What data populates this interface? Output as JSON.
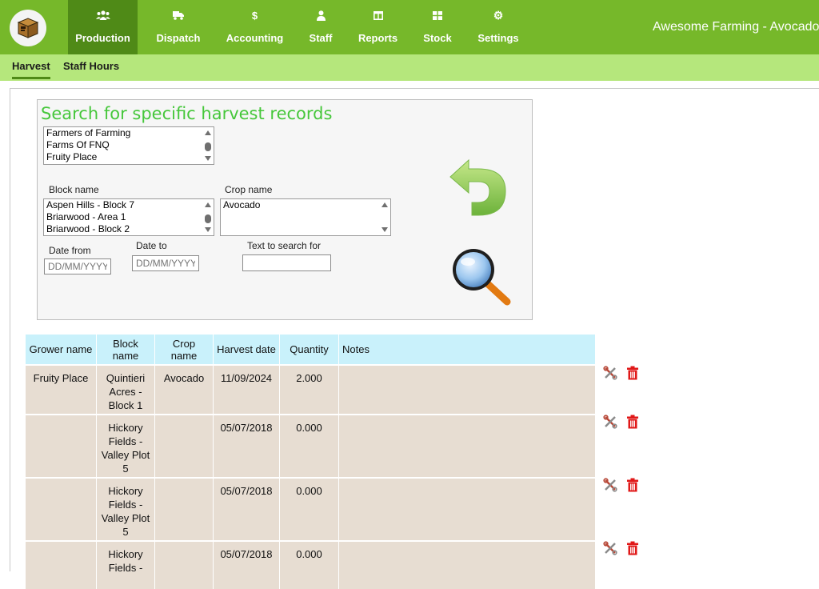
{
  "app": {
    "title": "Awesome Farming - Avocado"
  },
  "nav": [
    {
      "id": "production",
      "label": "Production",
      "icon": "users-icon"
    },
    {
      "id": "dispatch",
      "label": "Dispatch",
      "icon": "truck-icon"
    },
    {
      "id": "accounting",
      "label": "Accounting",
      "icon": "dollar-icon"
    },
    {
      "id": "staff",
      "label": "Staff",
      "icon": "user-icon"
    },
    {
      "id": "reports",
      "label": "Reports",
      "icon": "columns-icon"
    },
    {
      "id": "stock",
      "label": "Stock",
      "icon": "grid-icon"
    },
    {
      "id": "settings",
      "label": "Settings",
      "icon": "gear-icon"
    }
  ],
  "subnav": [
    {
      "label": "Harvest",
      "active": true
    },
    {
      "label": "Staff Hours",
      "active": false
    }
  ],
  "search": {
    "title": "Search for specific harvest records",
    "growers": [
      "Farmers of Farming",
      "Farms Of FNQ",
      "Fruity Place"
    ],
    "block_label": "Block name",
    "blocks": [
      "Aspen Hills - Block 7",
      "Briarwood - Area 1",
      "Briarwood - Block 2"
    ],
    "crop_label": "Crop name",
    "crops": [
      "Avocado"
    ],
    "date_from_label": "Date from",
    "date_to_label": "Date to",
    "date_placeholder": "DD/MM/YYYY",
    "text_label": "Text to search for",
    "text_value": "",
    "back_icon": "undo-arrow-icon",
    "search_icon": "magnifier-icon"
  },
  "table": {
    "headers": [
      "Grower name",
      "Block name",
      "Crop name",
      "Harvest date",
      "Quantity",
      "Notes"
    ],
    "rows": [
      {
        "grower": "Fruity Place",
        "block": "Quintieri Acres - Block 1",
        "crop": "Avocado",
        "date": "11/09/2024",
        "quantity": "2.000",
        "notes": ""
      },
      {
        "grower": "",
        "block": "Hickory Fields - Valley Plot 5",
        "crop": "",
        "date": "05/07/2018",
        "quantity": "0.000",
        "notes": ""
      },
      {
        "grower": "",
        "block": "Hickory Fields - Valley Plot 5",
        "crop": "",
        "date": "05/07/2018",
        "quantity": "0.000",
        "notes": ""
      },
      {
        "grower": "",
        "block": "Hickory Fields -",
        "crop": "",
        "date": "05/07/2018",
        "quantity": "0.000",
        "notes": ""
      }
    ],
    "actions": [
      "edit-tools-icon",
      "trash-icon"
    ]
  },
  "colors": {
    "topbar": "#76b82a",
    "active_nav": "#4f8a17",
    "subbar": "#b5e77c",
    "title_green": "#46c73b",
    "header_bg": "#c9f1fb",
    "row_bg": "#e7ddd2",
    "delete_red": "#e01818"
  }
}
